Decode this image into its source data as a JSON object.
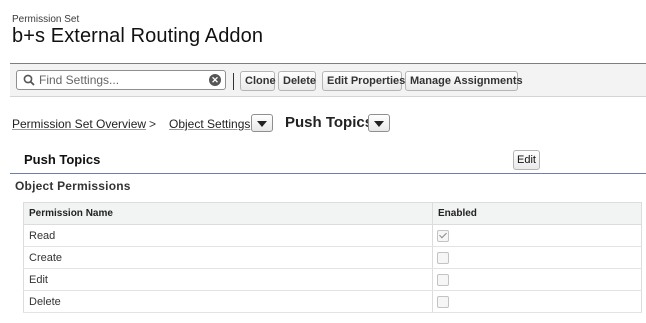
{
  "header": {
    "label": "Permission Set",
    "title": "b+s External Routing Addon"
  },
  "toolbar": {
    "search_placeholder": "Find Settings...",
    "buttons": [
      "Clone",
      "Delete",
      "Edit Properties",
      "Manage Assignments"
    ]
  },
  "breadcrumb": {
    "items": [
      "Permission Set Overview",
      "Object Settings"
    ],
    "separator": ">",
    "current": "Push Topics"
  },
  "section": {
    "title": "Push Topics",
    "edit_label": "Edit",
    "subtitle": "Object Permissions"
  },
  "table": {
    "columns": [
      "Permission Name",
      "Enabled"
    ],
    "rows": [
      {
        "name": "Read",
        "enabled": true
      },
      {
        "name": "Create",
        "enabled": false
      },
      {
        "name": "Edit",
        "enabled": false
      },
      {
        "name": "Delete",
        "enabled": false
      }
    ]
  },
  "icons": {
    "search": "magnifier-icon",
    "clear": "clear-icon",
    "dropdown": "chevron-down-icon"
  }
}
